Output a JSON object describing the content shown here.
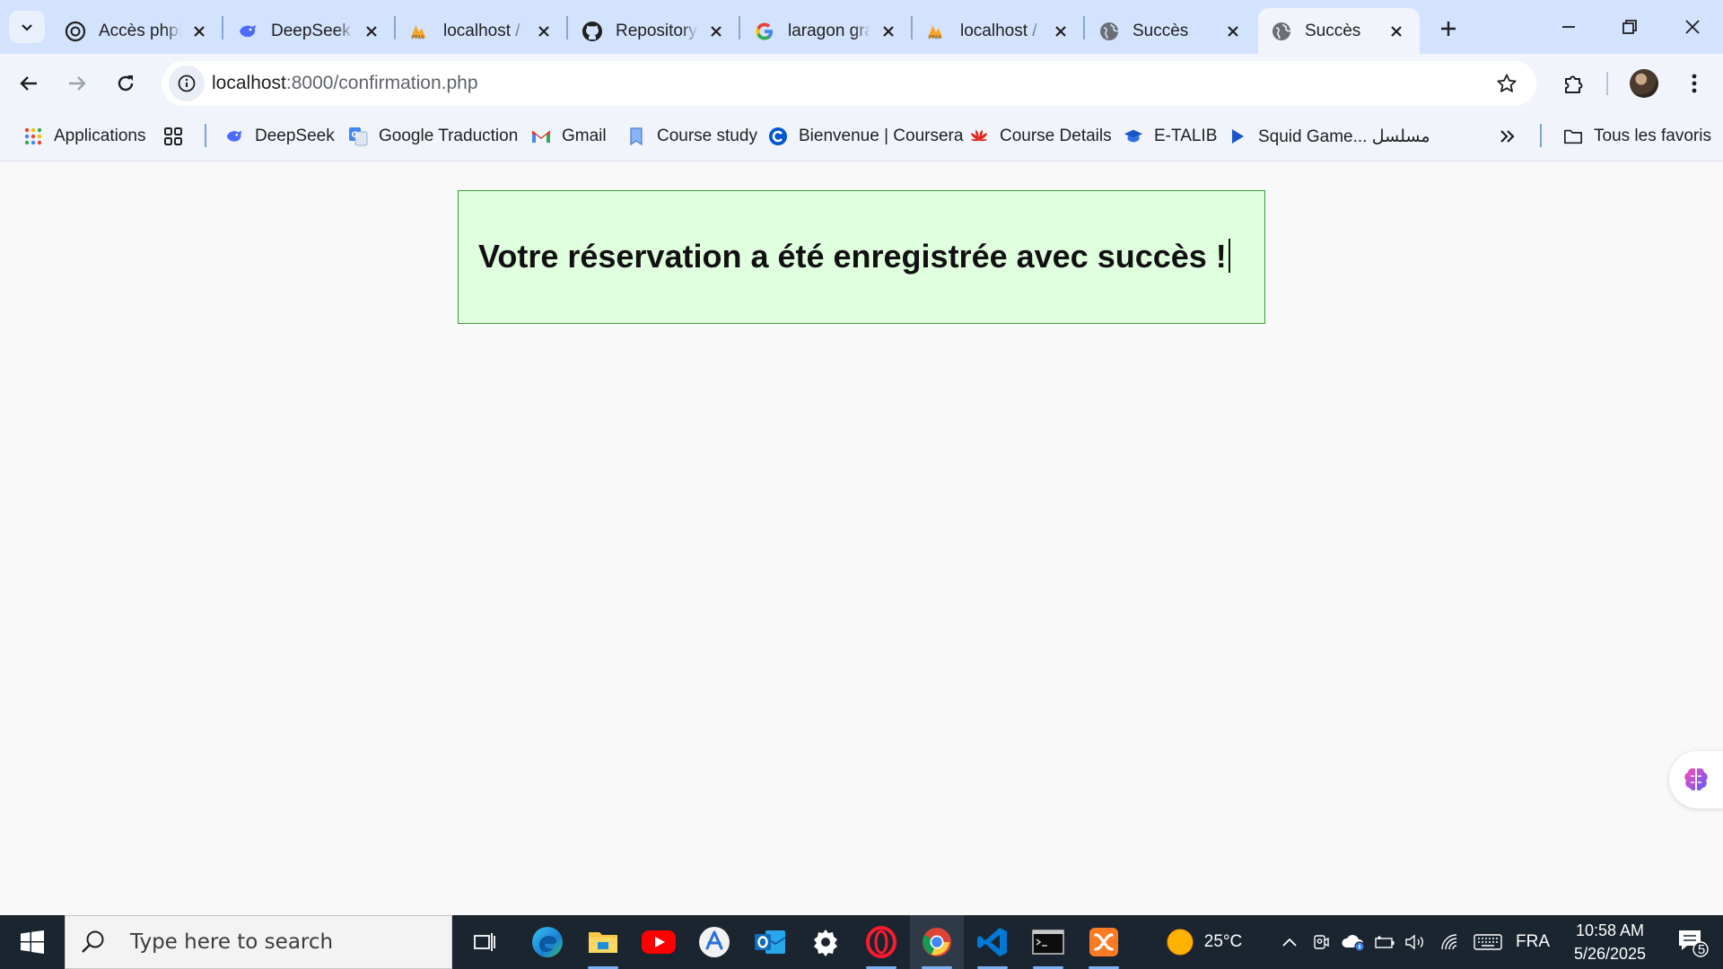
{
  "browser": {
    "tabs": [
      {
        "title": "Accès phpMyAdmin",
        "icon": "openai-icon"
      },
      {
        "title": "DeepSeek",
        "icon": "deepseek-icon"
      },
      {
        "title": "localhost / phpMyAdmin",
        "icon": "phpmyadmin-icon"
      },
      {
        "title": "Repository",
        "icon": "github-icon"
      },
      {
        "title": "laragon graphique",
        "icon": "google-icon"
      },
      {
        "title": "localhost / phpMyAdmin",
        "icon": "phpmyadmin-icon"
      },
      {
        "title": "Succès",
        "icon": "globe-icon"
      },
      {
        "title": "Succès",
        "icon": "globe-icon",
        "active": true
      }
    ],
    "address": {
      "host": "localhost",
      "path": ":8000/confirmation.php"
    },
    "bookmarks": [
      {
        "label": "Applications",
        "icon": "apps-grid-icon"
      },
      {
        "label": "DeepSeek",
        "icon": "deepseek-icon"
      },
      {
        "label": "Google Traduction",
        "icon": "google-translate-icon"
      },
      {
        "label": "Gmail",
        "icon": "gmail-icon"
      },
      {
        "label": "Course study",
        "icon": "bookmark-icon"
      },
      {
        "label": "Bienvenue | Coursera",
        "icon": "coursera-icon"
      },
      {
        "label": "Course Details",
        "icon": "huawei-icon"
      },
      {
        "label": "E-TALIB",
        "icon": "graduation-cap-icon"
      },
      {
        "label": "Squid Game... مسلسل",
        "icon": "play-icon"
      }
    ],
    "all_bookmarks_label": "Tous les favoris"
  },
  "page": {
    "message": "Votre réservation a été enregistrée avec succès !"
  },
  "taskbar": {
    "search_placeholder": "Type here to search",
    "weather": "25°C",
    "language": "FRA",
    "time": "10:58 AM",
    "date": "5/26/2025",
    "notification_count": "5"
  },
  "colors": {
    "tabstrip": "#d3e3fd",
    "toolbar": "#f1f5fb",
    "success_bg": "#dfffdf",
    "success_border": "#3c9a3c",
    "taskbar": "#1b2530"
  }
}
